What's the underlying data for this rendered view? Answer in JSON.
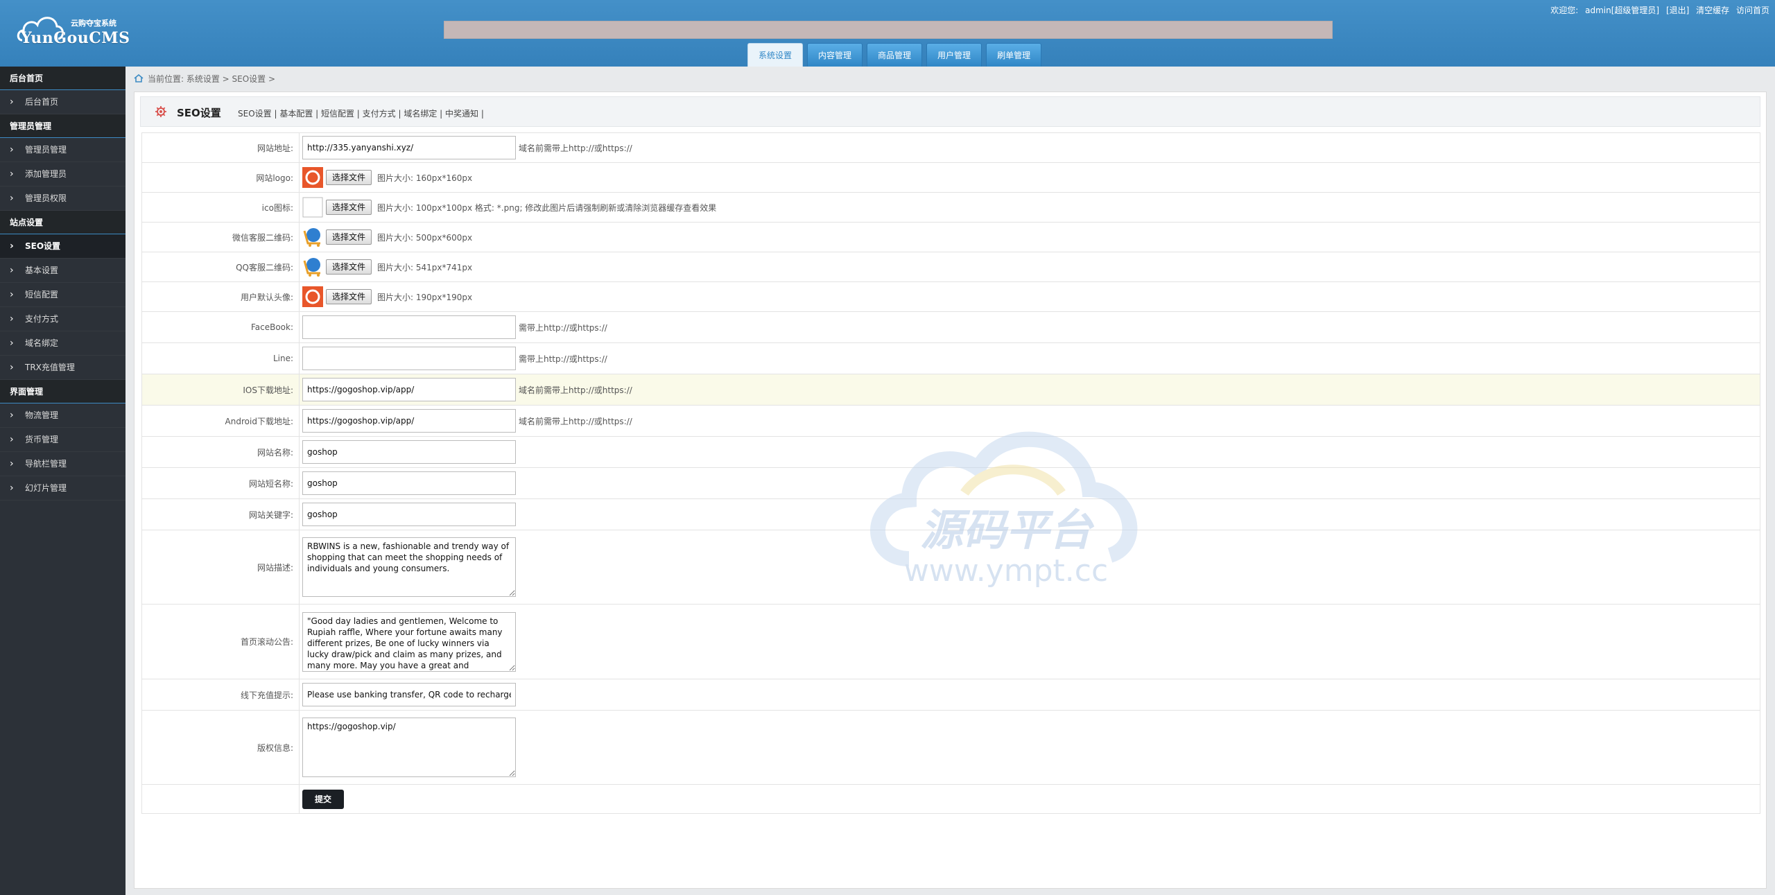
{
  "header": {
    "logo_sub": "云购夺宝系统",
    "logo_brand": "YunGouCMS",
    "welcome": "欢迎您:",
    "user": "admin[超级管理员]",
    "logout": "[退出]",
    "clear_cache": "清空缓存",
    "visit_home": "访问首页",
    "tabs": [
      {
        "label": "系统设置"
      },
      {
        "label": "内容管理"
      },
      {
        "label": "商品管理"
      },
      {
        "label": "用户管理"
      },
      {
        "label": "刷单管理"
      }
    ]
  },
  "sidebar": {
    "sections": [
      {
        "title": "后台首页",
        "items": [
          "后台首页"
        ]
      },
      {
        "title": "管理员管理",
        "items": [
          "管理员管理",
          "添加管理员",
          "管理员权限"
        ]
      },
      {
        "title": "站点设置",
        "items": [
          "SEO设置",
          "基本设置",
          "短信配置",
          "支付方式",
          "域名绑定",
          "TRX充值管理"
        ]
      },
      {
        "title": "界面管理",
        "items": [
          "物流管理",
          "货币管理",
          "导航栏管理",
          "幻灯片管理"
        ]
      }
    ]
  },
  "breadcrumb": "当前位置: 系统设置 > SEO设置 >",
  "panel": {
    "title": "SEO设置",
    "links": "SEO设置 | 基本配置 | 短信配置 | 支付方式 | 域名绑定 | 中奖通知 |"
  },
  "form": {
    "site_url": {
      "label": "网站地址:",
      "value": "http://335.yanyanshi.xyz/",
      "hint": "域名前需带上http://或https://"
    },
    "site_logo": {
      "label": "网站logo:",
      "button": "选择文件",
      "hint": "图片大小: 160px*160px"
    },
    "ico": {
      "label": "ico图标:",
      "button": "选择文件",
      "hint": "图片大小: 100px*100px  格式: *.png; 修改此图片后请强制刷新或清除浏览器缓存查看效果"
    },
    "wechat_qr": {
      "label": "微信客服二维码:",
      "button": "选择文件",
      "hint": "图片大小: 500px*600px"
    },
    "qq_qr": {
      "label": "QQ客服二维码:",
      "button": "选择文件",
      "hint": "图片大小: 541px*741px"
    },
    "avatar": {
      "label": "用户默认头像:",
      "button": "选择文件",
      "hint": "图片大小: 190px*190px"
    },
    "facebook": {
      "label": "FaceBook:",
      "value": "",
      "hint": "需带上http://或https://"
    },
    "line": {
      "label": "Line:",
      "value": "",
      "hint": "需带上http://或https://"
    },
    "ios": {
      "label": "IOS下载地址:",
      "value": "https://gogoshop.vip/app/",
      "hint": "域名前需带上http://或https://"
    },
    "android": {
      "label": "Android下载地址:",
      "value": "https://gogoshop.vip/app/",
      "hint": "域名前需带上http://或https://"
    },
    "site_name": {
      "label": "网站名称:",
      "value": "goshop"
    },
    "site_short": {
      "label": "网站短名称:",
      "value": "goshop"
    },
    "keywords": {
      "label": "网站关键字:",
      "value": "goshop"
    },
    "description": {
      "label": "网站描述:",
      "value": "RBWINS is a new, fashionable and trendy way of shopping that can meet the shopping needs of individuals and young consumers."
    },
    "notice": {
      "label": "首页滚动公告:",
      "value": "\"Good day ladies and gentlemen, Welcome to Rupiah raffle, Where your fortune awaits many different prizes, Be one of lucky winners via lucky draw/pick and claim as many prizes, and many more. May you have a great and wonderful day a"
    },
    "recharge_tip": {
      "label": "线下充值提示:",
      "value": "Please use banking transfer, QR code to recharge"
    },
    "copyright": {
      "label": "版权信息:",
      "value": "https://gogoshop.vip/"
    },
    "submit": "提交"
  },
  "watermark": {
    "text": "源码平台",
    "url": "www.ympt.cc"
  },
  "colors": {
    "header": "#3d8bc4",
    "sidebar": "#2c3138",
    "highlight_row": "#fafae9"
  }
}
